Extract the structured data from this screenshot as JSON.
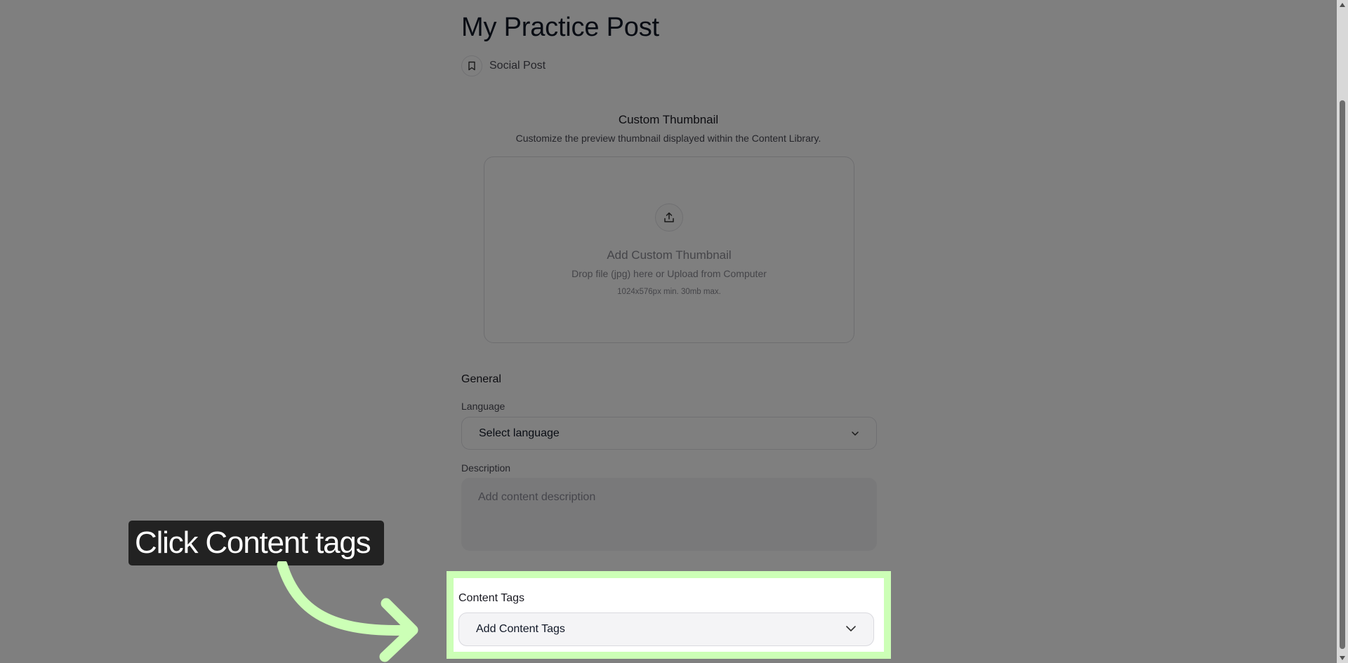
{
  "post": {
    "title": "My Practice Post",
    "type_label": "Social Post",
    "type_icon": "bookmark-icon"
  },
  "thumbnail": {
    "heading": "Custom Thumbnail",
    "description": "Customize the preview thumbnail displayed within the Content Library.",
    "upload_icon": "upload-icon",
    "drop_title": "Add Custom Thumbnail",
    "drop_hint": "Drop file (jpg) here or Upload from Computer",
    "size_limit": "1024x576px min. 30mb max."
  },
  "general": {
    "section_title": "General",
    "language_label": "Language",
    "language_value": "Select language",
    "description_label": "Description",
    "description_placeholder": "Add content description"
  },
  "content_tags": {
    "label": "Content Tags",
    "placeholder": "Add Content Tags"
  },
  "guide": {
    "callout_text": "Click Content tags",
    "highlight_color": "#ccffb6",
    "callout_bg": "#222222"
  }
}
